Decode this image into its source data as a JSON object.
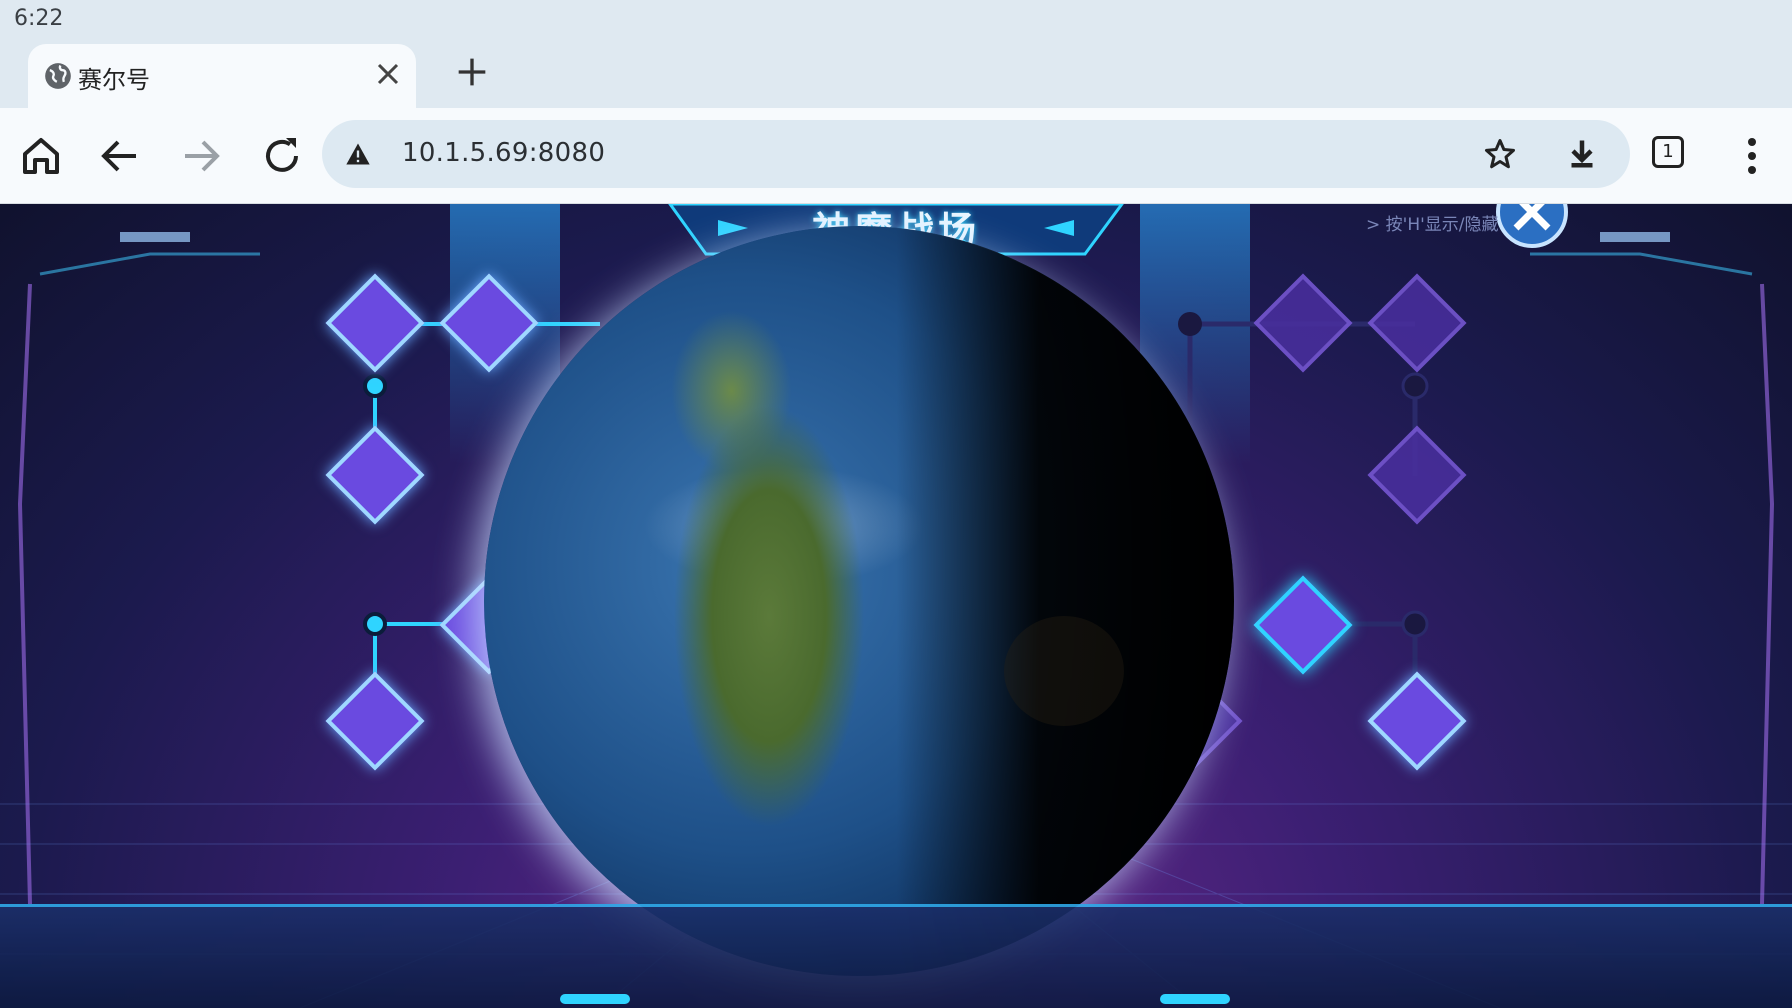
{
  "status_bar": {
    "time": "6:22"
  },
  "tab": {
    "title": "赛尔号",
    "close_icon": "close-icon",
    "favicon": "globe-icon"
  },
  "new_tab": {
    "icon": "plus-icon"
  },
  "toolbar": {
    "home_icon": "home-icon",
    "back_icon": "arrow-left-icon",
    "forward_icon": "arrow-right-icon",
    "reload_icon": "reload-icon",
    "security_icon": "warning-triangle-icon",
    "url": "10.1.5.69:8080",
    "bookmark_icon": "star-icon",
    "download_icon": "download-icon",
    "tab_count": "1",
    "menu_icon": "more-vert-icon"
  },
  "game": {
    "title": "神魔战场",
    "hint": "> 按'H'显示/隐藏",
    "close_icon": "close-circle-icon",
    "globe_image": "earth-globe",
    "colors": {
      "accent": "#2fd4ff",
      "node": "#7a4cf0",
      "locked": "#5a3aa8",
      "bg": "#1b1a4d"
    }
  }
}
